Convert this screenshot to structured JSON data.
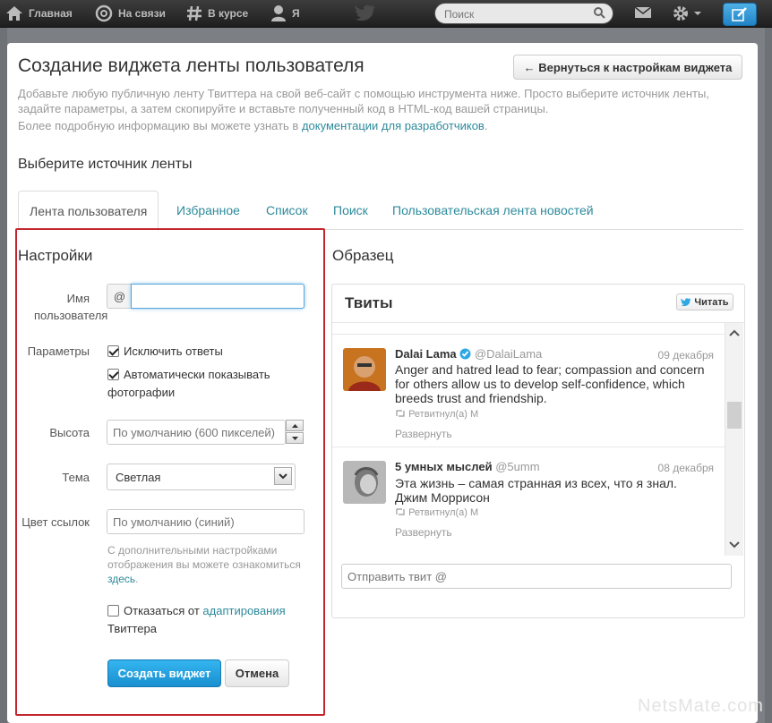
{
  "topnav": {
    "items": [
      {
        "label": "Главная",
        "icon": "home-icon"
      },
      {
        "label": "На связи",
        "icon": "at-icon"
      },
      {
        "label": "В курсе",
        "icon": "hash-icon"
      },
      {
        "label": "Я",
        "icon": "user-icon"
      }
    ],
    "search_placeholder": "Поиск"
  },
  "page": {
    "title": "Создание виджета ленты пользователя",
    "back_button": "← Вернуться к настройкам виджета",
    "description": "Добавьте любую публичную ленту Твиттера на свой веб-сайт с помощью инструмента ниже. Просто выберите источник ленты, задайте параметры, а затем скопируйте и вставьте полученный код в HTML-код вашей страницы.",
    "more_info_prefix": "Более подробную информацию вы можете узнать в ",
    "more_info_link": "документации для разработчиков",
    "more_info_suffix": ".",
    "source_title": "Выберите источник ленты"
  },
  "tabs": [
    "Лента пользователя",
    "Избранное",
    "Список",
    "Поиск",
    "Пользовательская лента новостей"
  ],
  "settings": {
    "title": "Настройки",
    "username_label_1": "Имя",
    "username_label_2": "пользователя",
    "at": "@",
    "username_value": "",
    "params_label": "Параметры",
    "exclude_replies": "Исключить ответы",
    "auto_photos_1": "Автоматически показывать",
    "auto_photos_2": "фотографии",
    "height_label": "Высота",
    "height_placeholder": "По умолчанию (600 пикселей)",
    "theme_label": "Тема",
    "theme_value": "Светлая",
    "link_color_label": "Цвет ссылок",
    "link_color_placeholder": "По умолчанию (синий)",
    "hint_1": "С дополнительными настройками",
    "hint_2": "отображения вы можете ознакомиться",
    "hint_link": "здесь",
    "hint_end": ".",
    "optout_prefix": "Отказаться от ",
    "optout_link": "адаптирования",
    "optout_2": "Твиттера",
    "create_button": "Создать виджет",
    "cancel_button": "Отмена"
  },
  "preview": {
    "title": "Образец",
    "widget_title": "Твиты",
    "follow_button": "Читать",
    "tweets": [
      {
        "name": "Dalai Lama",
        "handle": "@DalaiLama",
        "date": "09 декабря",
        "text": "Anger and hatred lead to fear; compassion and concern for others allow us to develop self-confidence, which breeds trust and friendship.",
        "retweeted": "Ретвитнул(а) М",
        "expand": "Развернуть"
      },
      {
        "name": "5 умных мыслей",
        "handle": "@5umm",
        "date": "08 декабря",
        "text": "Эта жизнь – самая странная из всех, что я знал. Джим Моррисон",
        "retweeted": "Ретвитнул(а) М",
        "expand": "Развернуть"
      }
    ],
    "tweet_box": "Отправить твит @"
  },
  "watermark": "NetsMate.com",
  "colors": {
    "accent": "#2d8a9b",
    "highlight": "#c3262e",
    "primary": "#1a8fcf"
  }
}
